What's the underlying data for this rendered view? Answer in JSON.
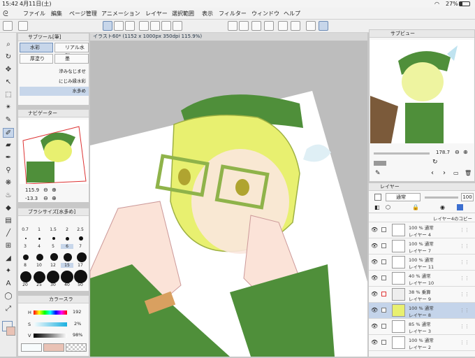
{
  "status": {
    "time": "15:42",
    "date": "4月11日(土)",
    "battery": "27%"
  },
  "menu": {
    "items": [
      "ファイル",
      "編集",
      "ページ管理",
      "アニメーション",
      "レイヤー",
      "選択範囲",
      "表示",
      "フィルター",
      "ウィンドウ",
      "ヘルプ"
    ]
  },
  "document": {
    "tab_label": "イラスト60* (1152 x 1000px 350dpi 115.9%)"
  },
  "subtool": {
    "title": "サブツール[筆]",
    "items": [
      "水彩",
      "リアル水彩",
      "厚塗り",
      "墨"
    ],
    "brushes": [
      "滲みなじませ",
      "にじみ縁水彩",
      "水多め"
    ]
  },
  "navigator": {
    "title": "ナビゲーター",
    "zoom": "115.9",
    "angle": "-13.3"
  },
  "brushsize": {
    "title": "ブラシサイズ[水多め]",
    "sizes": [
      "0.7",
      "1",
      "1.5",
      "2",
      "2.5",
      "3",
      "4",
      "5",
      "6",
      "7",
      "8",
      "10",
      "12",
      "15",
      "17",
      "20",
      "25",
      "30",
      "40",
      "50"
    ]
  },
  "color": {
    "title": "カラースラ",
    "h_label": "H",
    "s_label": "S",
    "v_label": "V",
    "h_val": "192",
    "s_val": "2%",
    "v_val": "98%",
    "main_color": "#f7fbfc",
    "sub_color": "#e9c2b5"
  },
  "subview": {
    "title": "サブビュー",
    "value": "178.7"
  },
  "layer": {
    "tab_label": "レイヤー",
    "blend": "通常",
    "opacity": "100",
    "rows": [
      {
        "mode": "",
        "name": "レイヤー4のコピー"
      },
      {
        "mode": "100 % 通常",
        "name": "レイヤー 4"
      },
      {
        "mode": "100 % 通常",
        "name": "レイヤー 7"
      },
      {
        "mode": "100 % 通常",
        "name": "レイヤー 11"
      },
      {
        "mode": "40 % 通常",
        "name": "レイヤー 10"
      },
      {
        "mode": "38 % 乗算",
        "name": "レイヤー 9"
      },
      {
        "mode": "100 % 通常",
        "name": "レイヤー 8"
      },
      {
        "mode": "85 % 通常",
        "name": "レイヤー 3"
      },
      {
        "mode": "100 % 通常",
        "name": "レイヤー 2"
      }
    ]
  },
  "colors": {
    "accent": "#6f8fba",
    "selected_bg": "#c4d4ea",
    "hat_green": "#4f8f3a",
    "hair_yellow": "#e8f070"
  }
}
